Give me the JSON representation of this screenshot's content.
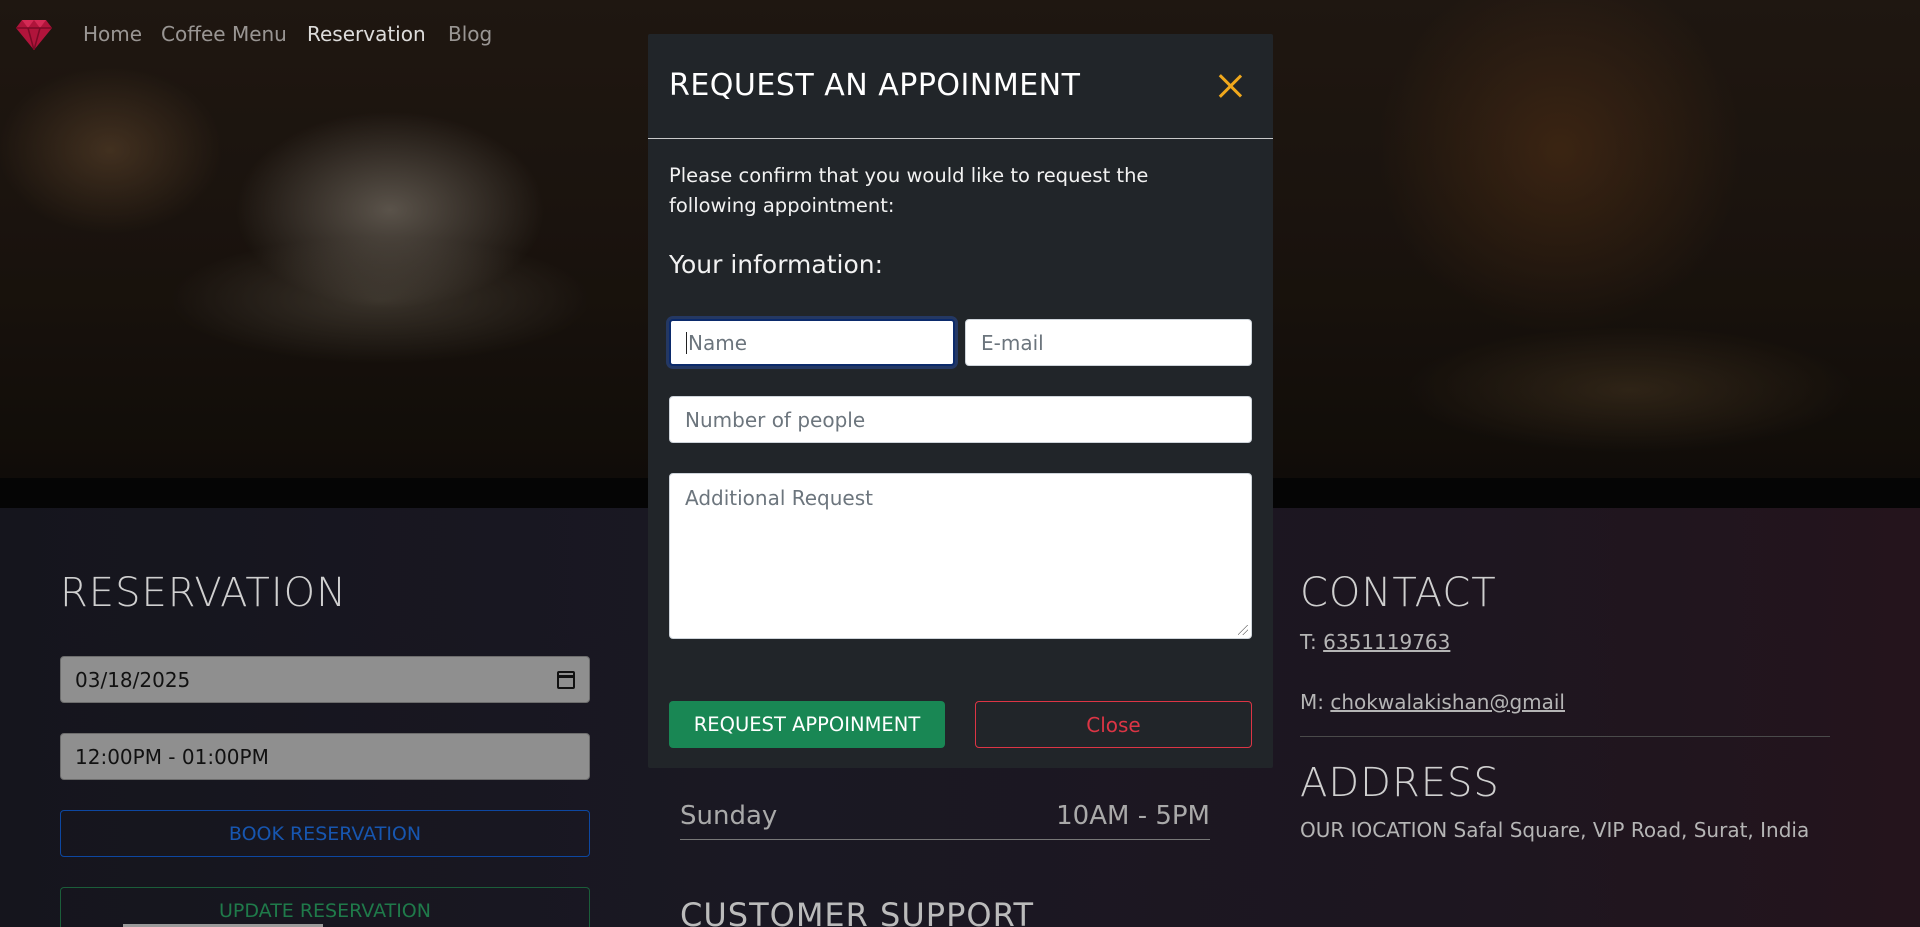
{
  "nav": {
    "logo_icon": "gem-icon",
    "links": [
      {
        "label": "Home",
        "active": false
      },
      {
        "label": "Coffee Menu",
        "active": false
      },
      {
        "label": "Reservation",
        "active": true
      },
      {
        "label": "Blog",
        "active": false
      }
    ]
  },
  "reservation": {
    "title": "RESERVATION",
    "date_value": "03/18/2025",
    "time_value": "12:00PM - 01:00PM",
    "book_label": "BOOK RESERVATION",
    "update_label": "UPDATE RESERVATION"
  },
  "hours": {
    "day": "Sunday",
    "time": "10AM - 5PM",
    "support_title": "CUSTOMER SUPPORT"
  },
  "contact": {
    "title": "CONTACT",
    "phone_prefix": "T:",
    "phone": "6351119763",
    "mail_prefix": "M:",
    "email": "chokwalakishan@gmail",
    "address_title": "ADDRESS",
    "address": "OUR IOCATION Safal Square, VIP Road, Surat, India"
  },
  "modal": {
    "title": "REQUEST AN APPOINMENT",
    "message": "Please confirm that you would like to request the following appointment:",
    "subtitle": "Your information:",
    "name_placeholder": "Name",
    "email_placeholder": "E-mail",
    "people_placeholder": "Number of people",
    "request_placeholder": "Additional Request",
    "submit_label": "REQUEST APPOINMENT",
    "close_label": "Close"
  },
  "colors": {
    "accent_close_x": "#f0a81c",
    "submit_green": "#198754",
    "close_red": "#dc3545",
    "modal_bg": "#212529"
  }
}
